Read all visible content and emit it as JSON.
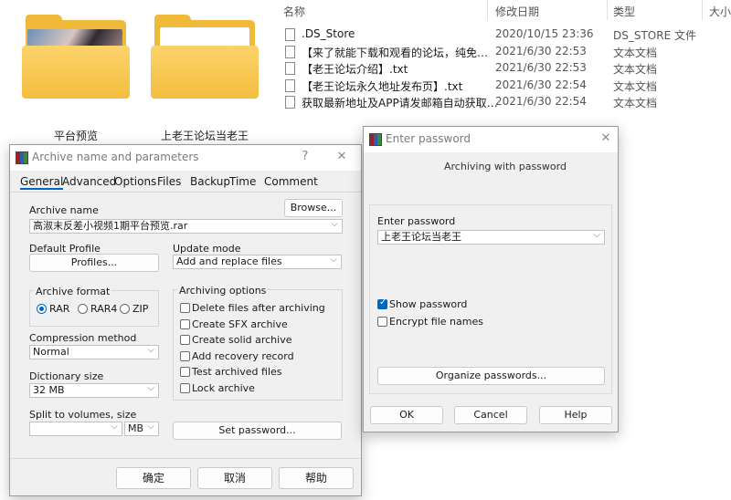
{
  "explorer": {
    "folders": [
      {
        "label": "平台预览",
        "has_thumbnail": true
      },
      {
        "label": "上老王论坛当老王",
        "has_thumbnail": false
      }
    ],
    "columns": {
      "name": "名称",
      "date": "修改日期",
      "type": "类型",
      "size": "大小"
    },
    "files": [
      {
        "name": ".DS_Store",
        "date": "2020/10/15 23:36",
        "type": "DS_STORE 文件"
      },
      {
        "name": "【来了就能下载和观看的论坛，纯免费！...",
        "date": "2021/6/30 22:53",
        "type": "文本文档"
      },
      {
        "name": "【老王论坛介绍】.txt",
        "date": "2021/6/30 22:53",
        "type": "文本文档"
      },
      {
        "name": "【老王论坛永久地址发布页】.txt",
        "date": "2021/6/30 22:54",
        "type": "文本文档"
      },
      {
        "name": "获取最新地址及APP请发邮箱自动获取.txt",
        "date": "2021/6/30 22:54",
        "type": "文本文档"
      }
    ]
  },
  "archive_dialog": {
    "title": "Archive name and parameters",
    "help_glyph": "?",
    "close_glyph": "✕",
    "tabs": [
      "General",
      "Advanced",
      "Options",
      "Files",
      "Backup",
      "Time",
      "Comment"
    ],
    "archive_name_label": "Archive name",
    "archive_name_value": "高淑末反差小视频1期平台预览.rar",
    "browse_label": "Browse...",
    "default_profile_label": "Default Profile",
    "profiles_label": "Profiles...",
    "update_mode_label": "Update mode",
    "update_mode_value": "Add and replace files",
    "archive_format_label": "Archive format",
    "formats": [
      {
        "label": "RAR",
        "selected": true
      },
      {
        "label": "RAR4",
        "selected": false
      },
      {
        "label": "ZIP",
        "selected": false
      }
    ],
    "compression_method_label": "Compression method",
    "compression_method_value": "Normal",
    "dictionary_size_label": "Dictionary size",
    "dictionary_size_value": "32 MB",
    "split_label": "Split to volumes, size",
    "split_value": "",
    "split_unit": "MB",
    "archiving_options_label": "Archiving options",
    "options": [
      {
        "label": "Delete files after archiving",
        "checked": false
      },
      {
        "label": "Create SFX archive",
        "checked": false
      },
      {
        "label": "Create solid archive",
        "checked": false
      },
      {
        "label": "Add recovery record",
        "checked": false
      },
      {
        "label": "Test archived files",
        "checked": false
      },
      {
        "label": "Lock archive",
        "checked": false
      }
    ],
    "set_password_label": "Set password...",
    "ok_label": "确定",
    "cancel_label": "取消",
    "help_label": "帮助"
  },
  "password_dialog": {
    "title": "Enter password",
    "close_glyph": "✕",
    "subtitle": "Archiving with password",
    "enter_password_label": "Enter password",
    "password_value": "上老王论坛当老王",
    "show_password_label": "Show password",
    "show_password_checked": true,
    "encrypt_names_label": "Encrypt file names",
    "encrypt_names_checked": false,
    "organize_label": "Organize passwords...",
    "ok_label": "OK",
    "cancel_label": "Cancel",
    "help_label": "Help"
  }
}
